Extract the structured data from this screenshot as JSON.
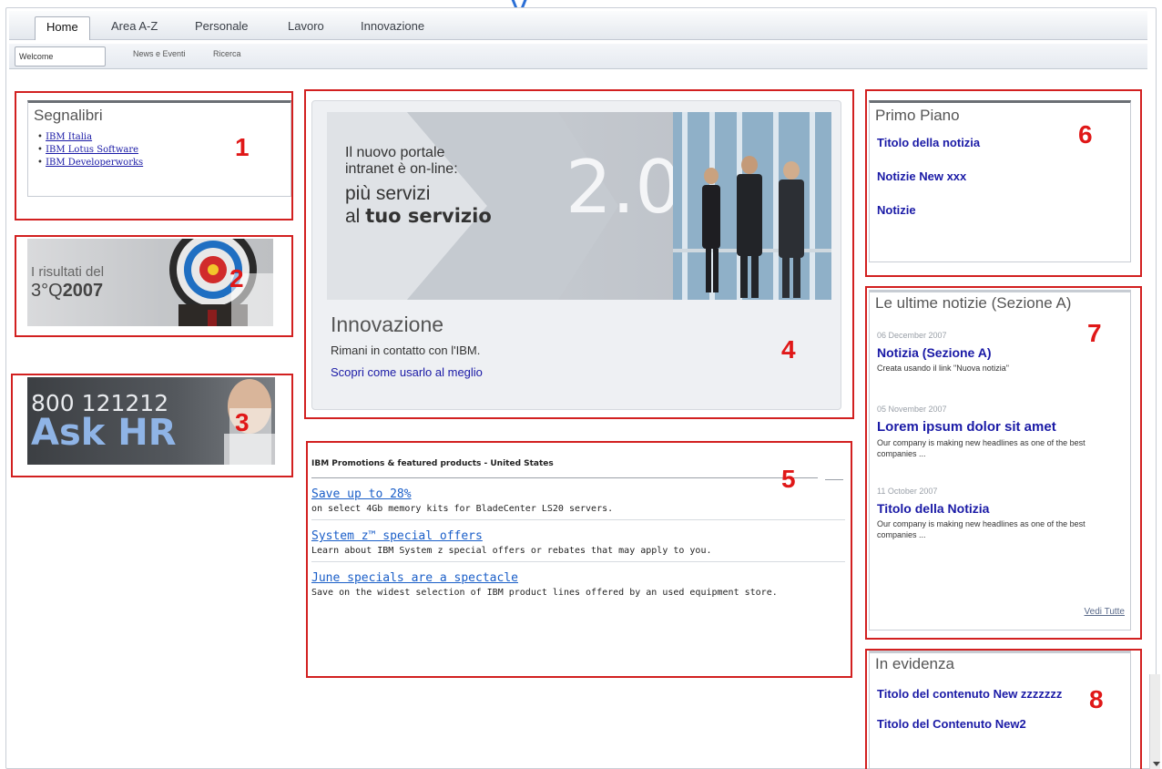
{
  "nav": {
    "tabs": [
      "Home",
      "Area A-Z",
      "Personale",
      "Lavoro",
      "Innovazione"
    ],
    "subtabs": [
      "Welcome",
      "News e Eventi",
      "Ricerca"
    ]
  },
  "bookmarks": {
    "title": "Segnalibri",
    "links": [
      "IBM Italia",
      "IBM Lotus Software",
      "IBM Developerworks"
    ]
  },
  "results_banner": {
    "line1": "I risultati del",
    "line2_prefix": "3°Q",
    "line2_year": "2007"
  },
  "hr_banner": {
    "phone": "800 121212",
    "label": "Ask HR"
  },
  "hero": {
    "headline1": "Il nuovo portale",
    "headline2": "intranet è on-line:",
    "headline3": "più servizi",
    "headline4_prefix": "al ",
    "headline4_bold": "tuo servizio",
    "version": "2.0",
    "title": "Innovazione",
    "subtitle": "Rimani in contatto con l'IBM.",
    "link": "Scopri come usarlo al meglio"
  },
  "promotions": {
    "title": "IBM Promotions & featured products - United States",
    "items": [
      {
        "link": "Save up to 28%",
        "text": "on select 4Gb memory kits for BladeCenter LS20 servers."
      },
      {
        "link": "System z™ special offers",
        "text": "Learn about IBM System z special offers or rebates that may apply to you."
      },
      {
        "link": "June specials are a spectacle",
        "text": "Save on the widest selection of IBM product lines offered by an used equipment store."
      }
    ]
  },
  "primo_piano": {
    "title": "Primo Piano",
    "items": [
      "Titolo della notizia",
      "Notizie New xxx",
      "Notizie"
    ]
  },
  "ultime_notizie": {
    "title": "Le ultime notizie (Sezione A)",
    "items": [
      {
        "date": "06 December 2007",
        "head": "Notizia (Sezione A)",
        "body": "Creata usando il link \"Nuova notizia\""
      },
      {
        "date": "05 November 2007",
        "head": "Lorem ipsum dolor sit amet",
        "body": "Our company is making new headlines as one of the best companies ..."
      },
      {
        "date": "11 October 2007",
        "head": "Titolo della Notizia",
        "body": "Our company is making new headlines as one of the best companies ..."
      }
    ],
    "more": "Vedi Tutte"
  },
  "in_evidenza": {
    "title": "In evidenza",
    "items": [
      "Titolo del contenuto New zzzzzzz",
      "Titolo del Contenuto New2"
    ]
  },
  "markers": [
    "1",
    "2",
    "3",
    "4",
    "5",
    "6",
    "7",
    "8"
  ]
}
